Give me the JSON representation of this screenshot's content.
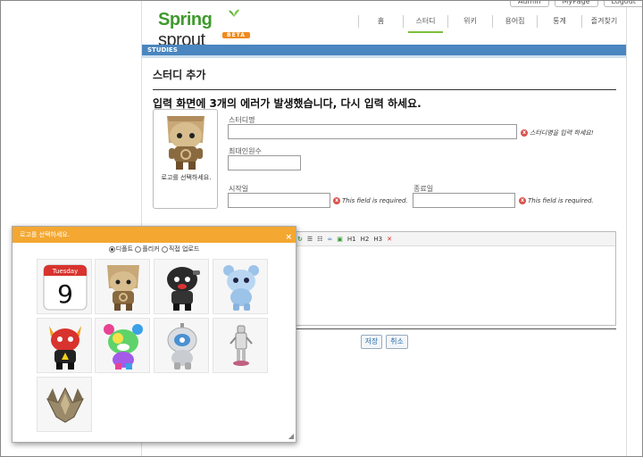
{
  "top_links": [
    "Admin",
    "MyPage",
    "Logout"
  ],
  "logo": {
    "spring": "Spring",
    "sprout": "sprout",
    "beta": "BETA"
  },
  "nav": [
    "홈",
    "스터디",
    "위키",
    "용어집",
    "통계",
    "즐겨찾기"
  ],
  "section_bar": "STUDIES",
  "page_heading": "스터디 추가",
  "error_summary": "입력 화면에 3개의 에러가 발생했습니다, 다시 입력 하세요.",
  "logo_select_label": "로고를 선택하세요.",
  "form": {
    "study_name_label": "스터디명",
    "study_name_value": "",
    "study_name_error": "스터디명을 입력 하세요!",
    "max_members_label": "최대인원수",
    "max_members_value": "",
    "start_label": "시작일",
    "start_value": "",
    "start_error": "This field is required.",
    "end_label": "종료일",
    "end_value": "",
    "end_error": "This field is required."
  },
  "editor_toolbar": [
    "H1",
    "H2",
    "H3"
  ],
  "buttons": {
    "save": "저장",
    "cancel": "취소"
  },
  "dialog": {
    "title": "로고를 선택하세요.",
    "close": "×",
    "options": [
      "디폴트",
      "플리커",
      "직접 업로드"
    ],
    "selected_option": "디폴트",
    "calendar_month": "Tuesday",
    "calendar_day": "9",
    "tiles": [
      "calendar-icon",
      "brown-mascot-icon",
      "black-mascot-icon",
      "blue-mascot-icon",
      "devil-mascot-icon",
      "rainbow-mascot-icon",
      "silver-mascot-icon",
      "robot-figure-icon",
      "ship-icon"
    ]
  },
  "colors": {
    "section_bar": "#4a86bf",
    "dialog_title": "#f4a731",
    "error": "#d9534f"
  }
}
